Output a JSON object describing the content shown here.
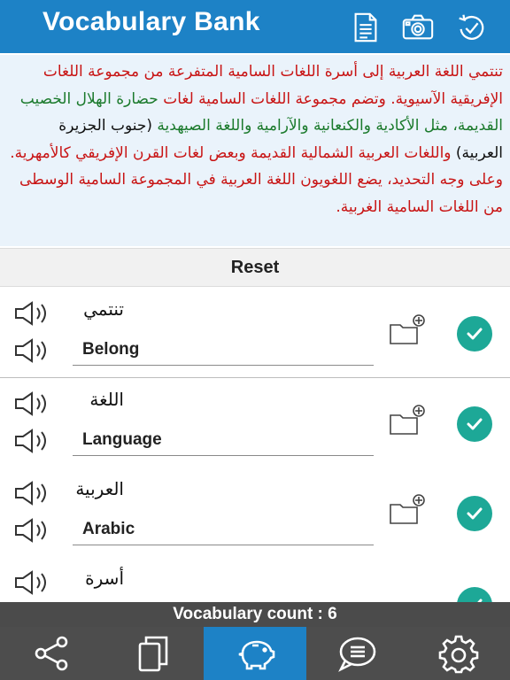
{
  "header": {
    "title": "Vocabulary Bank",
    "icons": [
      "document-icon",
      "camera-icon",
      "history-icon"
    ]
  },
  "passage": {
    "segments": [
      {
        "text": "تنتمي اللغة العربية إلى أسرة اللغات السامية المتفرعة من مجموعة اللغات الإفريقية الآسيوية. وتضم مجموعة اللغات السامية لغات ",
        "color": "red"
      },
      {
        "text": "حضارة الهلال الخصيب القديمة، مثل الأكادية والكنعانية والآرامية واللغة الصيهدية ",
        "color": "green"
      },
      {
        "text": "(جنوب الجزيرة العربية) ",
        "color": "black"
      },
      {
        "text": "واللغات العربية الشمالية القديمة وبعض لغات القرن الإفريقي كالأمهرية. وعلى وجه التحديد، يضع اللغويون اللغة العربية في المجموعة السامية الوسطى من اللغات السامية الغربية.",
        "color": "red"
      }
    ]
  },
  "reset_label": "Reset",
  "vocab": [
    {
      "arabic": "تنتمي",
      "english": "Belong"
    },
    {
      "arabic": "اللغة",
      "english": "Language"
    },
    {
      "arabic": "العربية",
      "english": "Arabic"
    },
    {
      "arabic": "أسرة",
      "english": ""
    }
  ],
  "row_icons": {
    "speaker": "speaker-icon",
    "folder": "folder-add-icon",
    "check": "checkmark-icon"
  },
  "count_label": "Vocabulary count : 6",
  "tabs": [
    {
      "name": "share",
      "icon": "share-icon",
      "active": false
    },
    {
      "name": "copy",
      "icon": "copy-icon",
      "active": false
    },
    {
      "name": "piggy-bank",
      "icon": "piggy-bank-icon",
      "active": true
    },
    {
      "name": "messages",
      "icon": "chat-bubble-icon",
      "active": false
    },
    {
      "name": "settings",
      "icon": "gear-icon",
      "active": false
    }
  ],
  "colors": {
    "primary": "#1d82c6",
    "accent": "#1da897",
    "red_text": "#c81414",
    "green_text": "#1b7a2c",
    "dark_bar": "#4b4b4b"
  }
}
